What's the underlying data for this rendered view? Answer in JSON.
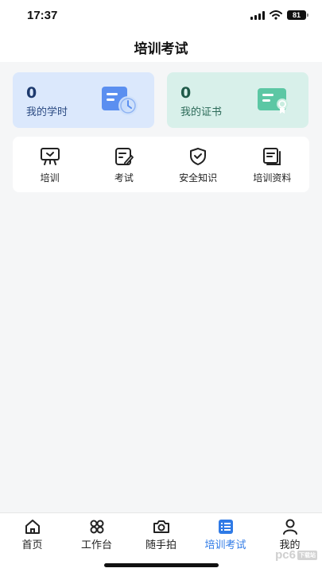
{
  "status_bar": {
    "time": "17:37",
    "battery": "81"
  },
  "nav": {
    "title": "培训考试"
  },
  "cards": [
    {
      "value": "0",
      "label": "我的学时",
      "icon": "clock-document-icon",
      "accent": "#4a86e8"
    },
    {
      "value": "0",
      "label": "我的证书",
      "icon": "certificate-icon",
      "accent": "#4fbf9a"
    }
  ],
  "menu": [
    {
      "label": "培训",
      "icon": "training-icon"
    },
    {
      "label": "考试",
      "icon": "exam-icon"
    },
    {
      "label": "安全知识",
      "icon": "shield-check-icon"
    },
    {
      "label": "培训资料",
      "icon": "documents-icon"
    }
  ],
  "tabbar": {
    "active": "培训考试",
    "tabs": [
      {
        "label": "首页",
        "icon": "home-icon"
      },
      {
        "label": "工作台",
        "icon": "grid-icon"
      },
      {
        "label": "随手拍",
        "icon": "camera-icon"
      },
      {
        "label": "培训考试",
        "icon": "list-icon"
      },
      {
        "label": "我的",
        "icon": "user-icon"
      }
    ]
  },
  "watermark": {
    "text": "pc6",
    "badge": "下载站"
  },
  "colors": {
    "primary": "#2f7ae6",
    "card_blue": "#dbe8fc",
    "card_green": "#d8f0ea"
  }
}
